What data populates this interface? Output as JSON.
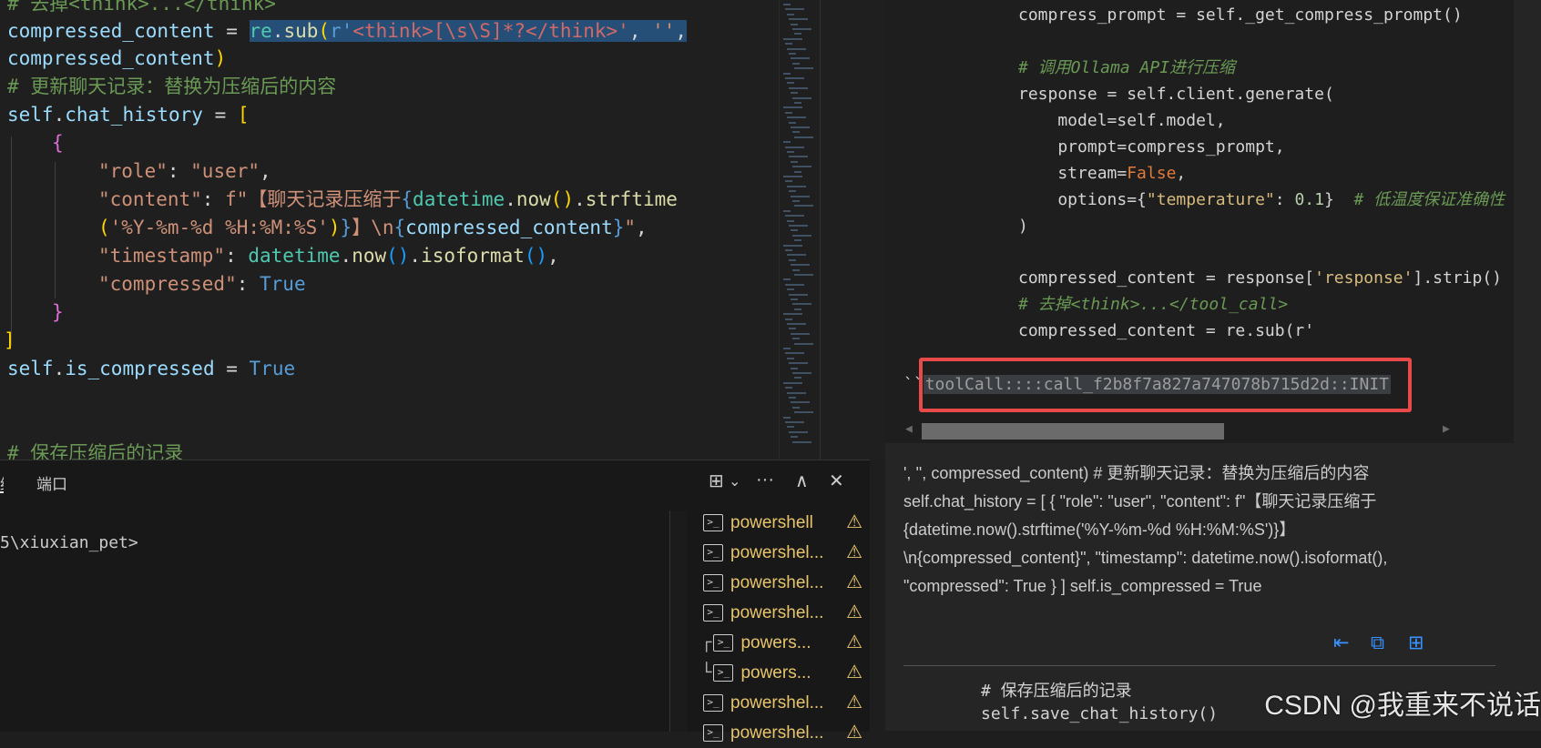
{
  "editor": {
    "lines": {
      "l0": "# 去掉<think>...</think>",
      "l1a": "compressed_content",
      "l1b": " = ",
      "l1c_fn": "re",
      "l1d": ".",
      "l1e": "sub",
      "l1f": "(",
      "l1g": "r'",
      "l1h": "<think>[\\s\\S]*?</think>",
      "l1i": "'",
      "l1j": ", ",
      "l1k": "''",
      "l1l": ",",
      "l2a": "compressed_content",
      "l2b": ")",
      "l3": "# 更新聊天记录：替换为压缩后的内容",
      "l4a": "self",
      "l4b": ".",
      "l4c": "chat_history",
      "l4d": " = ",
      "l4e": "[",
      "l5": "{",
      "l6a": "\"role\"",
      "l6b": ": ",
      "l6c": "\"user\"",
      "l6d": ",",
      "l7a": "\"content\"",
      "l7b": ": ",
      "l7c": "f\"【聊天记录压缩于",
      "l7d": "{",
      "l7e": "datetime",
      "l7f": ".",
      "l7g": "now",
      "l7h": "()",
      "l7i": ".",
      "l7j": "strftime",
      "l8a": "(",
      "l8b": "'%Y-%m-%d %H:%M:%S'",
      "l8c": ")",
      "l8d": "}",
      "l8e": "】\\n",
      "l8f": "{",
      "l8g": "compressed_content",
      "l8h": "}",
      "l8i": "\"",
      "l8j": ",",
      "l9a": "\"timestamp\"",
      "l9b": ": ",
      "l9c": "datetime",
      "l9d": ".",
      "l9e": "now",
      "l9f": "()",
      "l9g": ".",
      "l9h": "isoformat",
      "l9i": "()",
      "l9j": ",",
      "l10a": "\"compressed\"",
      "l10b": ": ",
      "l10c": "True",
      "l11": "}",
      "l12": "]",
      "l13a": "self",
      "l13b": ".",
      "l13c": "is_compressed",
      "l13d": " = ",
      "l13e": "True",
      "l15": "# 保存压缩后的记录"
    }
  },
  "panel": {
    "tab_terminal": "终端",
    "tab_ports": "端口",
    "terminal_text": "5\\xiuxian_pet>",
    "terminals": [
      {
        "label": "powershell",
        "tree": ""
      },
      {
        "label": "powershel...",
        "tree": ""
      },
      {
        "label": "powershel...",
        "tree": ""
      },
      {
        "label": "powershel...",
        "tree": ""
      },
      {
        "label": "powers...",
        "tree": "┌"
      },
      {
        "label": "powers...",
        "tree": "└"
      },
      {
        "label": "powershel...",
        "tree": ""
      },
      {
        "label": "powershel...",
        "tree": ""
      }
    ],
    "icons": {
      "split": "⊞",
      "chevron": "⌄",
      "more": "···",
      "up": "∧",
      "close": "✕",
      "warn": "⚠"
    }
  },
  "chat": {
    "code": {
      "c1": "compress_prompt = self._get_compress_prompt()",
      "c3": "# 调用Ollama API进行压缩",
      "c4": "response = self.client.generate(",
      "c5": "    model=self.model,",
      "c6": "    prompt=compress_prompt,",
      "c7a": "    stream=",
      "c7b": "False",
      "c7c": ",",
      "c8a": "    options={",
      "c8b": "\"temperature\"",
      "c8c": ": ",
      "c8d": "0.1",
      "c8e": "}  ",
      "c8f": "# 低温度保证准确性",
      "c9": ")",
      "c11a": "compressed_content = response[",
      "c11b": "'response'",
      "c11c": "].strip()",
      "c12": "# 去掉<think>...</tool_call>",
      "c13": "compressed_content = re.sub(r'",
      "tool_prefix": "``",
      "tool_call": "toolCall::::call_f2b8f7a827a747078b715d2d::INIT"
    },
    "prose": [
      "', '', compressed_content) # 更新聊天记录：替换为压缩后的内容",
      "self.chat_history = [ { \"role\": \"user\", \"content\": f\"【聊天记录压缩于",
      "{datetime.now().strftime('%Y-%m-%d %H:%M:%S')}】",
      "\\n{compressed_content}\", \"timestamp\": datetime.now().isoformat(),",
      "\"compressed\": True } ] self.is_compressed = True"
    ],
    "actions": {
      "insert": "⇤",
      "copy": "⧉",
      "new_file": "⊞"
    },
    "code2": {
      "d1": "# 保存压缩后的记录",
      "d2": "self.save_chat_history()"
    },
    "watermark": "CSDN @我重来不说话"
  },
  "colors": {
    "accent": "#3794ff",
    "highlight_box": "#e84a4a",
    "warning": "#e8c56b",
    "selection": "#264f78"
  }
}
